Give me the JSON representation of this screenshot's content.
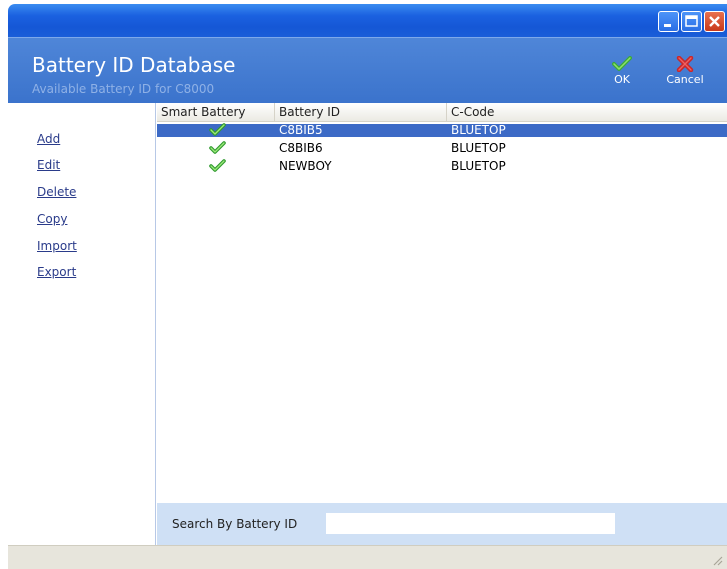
{
  "header": {
    "title": "Battery ID Database",
    "subtitle": "Available Battery ID for C8000",
    "ok_label": "OK",
    "cancel_label": "Cancel"
  },
  "sidebar": {
    "items": [
      {
        "label": "Add"
      },
      {
        "label": "Edit"
      },
      {
        "label": "Delete"
      },
      {
        "label": "Copy"
      },
      {
        "label": "Import"
      },
      {
        "label": "Export"
      }
    ]
  },
  "table": {
    "columns": [
      "Smart Battery",
      "Battery ID",
      "C-Code"
    ],
    "rows": [
      {
        "smart_battery": true,
        "battery_id": "C8BIB5",
        "c_code": "BLUETOP",
        "selected": true
      },
      {
        "smart_battery": true,
        "battery_id": "C8BIB6",
        "c_code": "BLUETOP",
        "selected": false
      },
      {
        "smart_battery": true,
        "battery_id": "NEWBOY",
        "c_code": "BLUETOP",
        "selected": false
      }
    ]
  },
  "search": {
    "label": "Search By Battery ID",
    "value": ""
  },
  "colors": {
    "header_bg": "#4f86d8",
    "selected_row": "#3c6ac6",
    "search_bg": "#cfe0f5",
    "check_green": "#3aa83a"
  }
}
